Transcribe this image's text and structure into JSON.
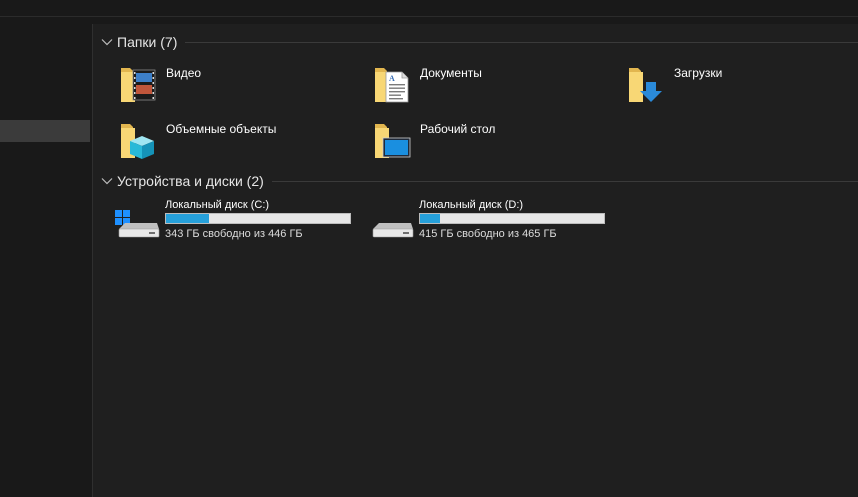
{
  "folders_group": {
    "title": "Папки (7)",
    "items": [
      {
        "label": "Видео",
        "icon": "videos-folder-icon"
      },
      {
        "label": "Документы",
        "icon": "documents-folder-icon"
      },
      {
        "label": "Загрузки",
        "icon": "downloads-folder-icon"
      },
      {
        "label": "Объемные объекты",
        "icon": "3d-objects-folder-icon"
      },
      {
        "label": "Рабочий стол",
        "icon": "desktop-folder-icon"
      }
    ]
  },
  "drives_group": {
    "title": "Устройства и диски (2)",
    "drives": [
      {
        "name": "Локальный диск (C:)",
        "free_text": "343 ГБ свободно из 446 ГБ",
        "used_fraction": 0.231
      },
      {
        "name": "Локальный диск (D:)",
        "free_text": "415 ГБ свободно из 465 ГБ",
        "used_fraction": 0.108
      }
    ]
  },
  "colors": {
    "background": "#191919",
    "content_background": "#1f1f1f",
    "sidebar_selected": "#3b3b3b",
    "usage_fill": "#26a0da",
    "usage_track": "#e6e6e6",
    "folder_yellow": "#f8d775"
  }
}
